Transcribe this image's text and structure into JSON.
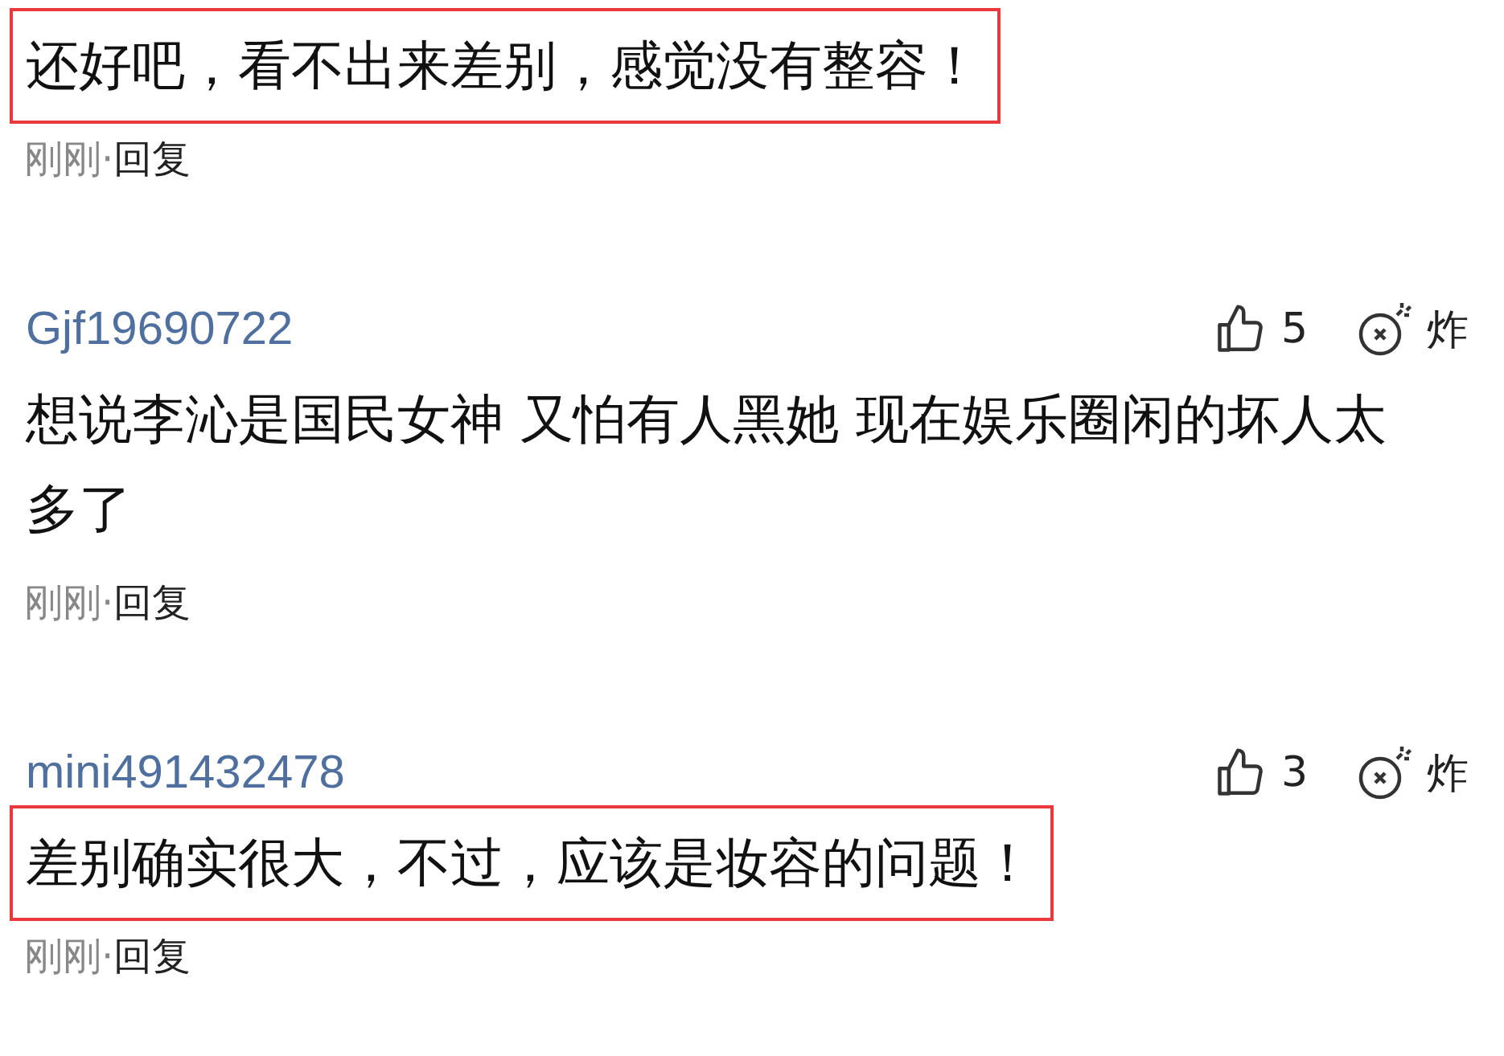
{
  "comments": [
    {
      "text": "还好吧，看不出来差别，感觉没有整容！",
      "highlighted": true,
      "time": "刚刚",
      "separator": "·",
      "reply": "回复"
    },
    {
      "username": "Gjf19690722",
      "likes": "5",
      "bomb": "炸",
      "text": "想说李沁是国民女神 又怕有人黑她 现在娱乐圈闲的坏人太多了",
      "highlighted": false,
      "time": "刚刚",
      "separator": "·",
      "reply": "回复"
    },
    {
      "username": "mini491432478",
      "likes": "3",
      "bomb": "炸",
      "text": "差别确实很大，不过，应该是妆容的问题！",
      "highlighted": true,
      "time": "刚刚",
      "separator": "·",
      "reply": "回复"
    }
  ]
}
